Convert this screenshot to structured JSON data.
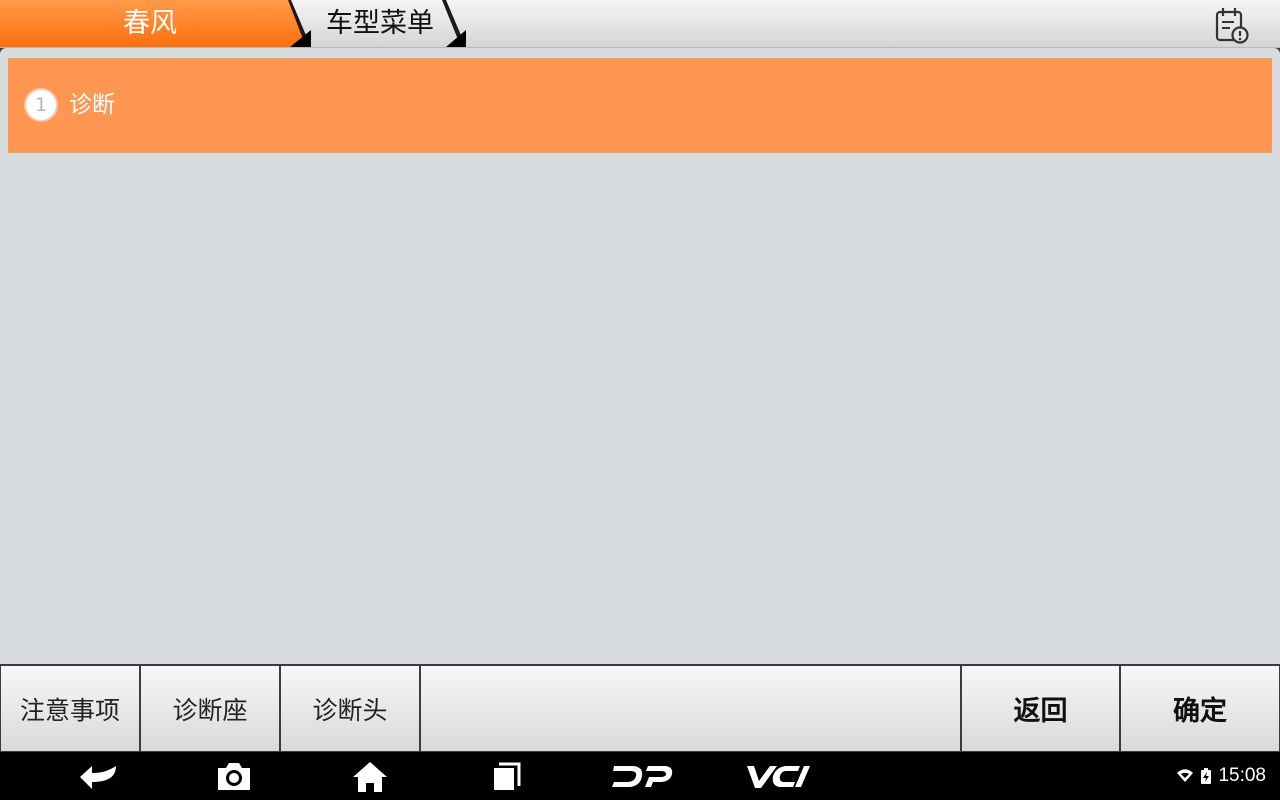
{
  "breadcrumb": [
    {
      "label": "春风"
    },
    {
      "label": "车型菜单"
    }
  ],
  "header_icons": {
    "report": "report-warning-icon"
  },
  "menu": [
    {
      "index": "1",
      "label": "诊断"
    }
  ],
  "function_bar": {
    "notice": "注意事项",
    "dlc": "诊断座",
    "connector": "诊断头",
    "back": "返回",
    "ok": "确定"
  },
  "nav_icons": [
    "back-icon",
    "camera-icon",
    "home-icon",
    "recent-apps-icon",
    "dp-logo-icon",
    "vci-icon"
  ],
  "status_bar": {
    "time": "15:08"
  },
  "colors": {
    "accent": "#ff7a1f",
    "selected_item": "#ff9753",
    "panel": "#d8dcdf",
    "bar_bg": "#3a3c3f"
  }
}
